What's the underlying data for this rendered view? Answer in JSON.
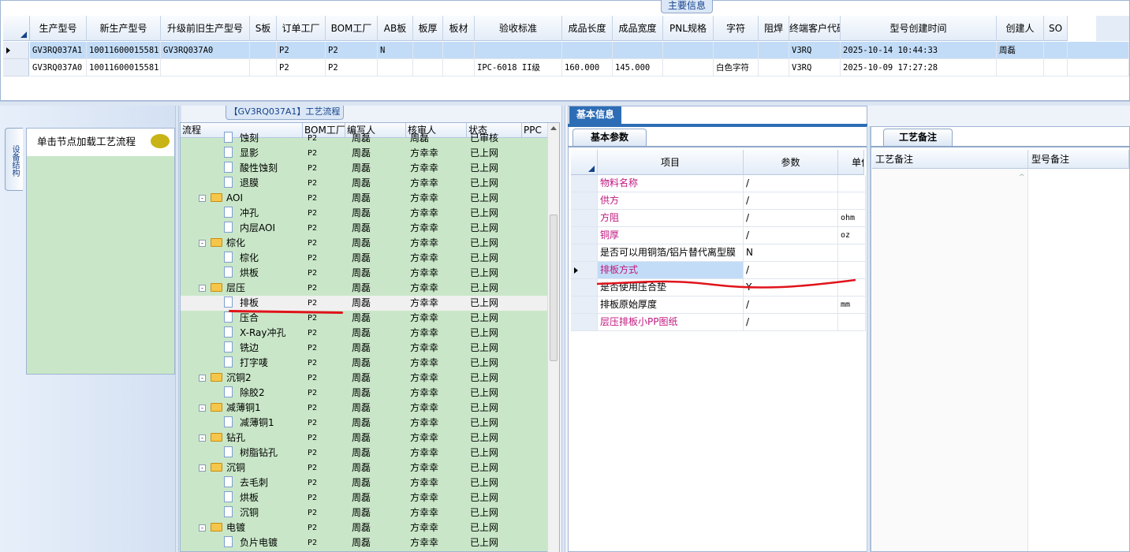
{
  "top": {
    "title": "主要信息",
    "columns": [
      "生产型号",
      "新生产型号",
      "升级前旧生产型号",
      "S板",
      "订单工厂",
      "BOM工厂",
      "AB板",
      "板厚",
      "板材",
      "验收标准",
      "成品长度",
      "成品宽度",
      "PNL规格",
      "字符",
      "阻焊",
      "终端客户代码",
      "型号创建时间",
      "创建人",
      "SO"
    ],
    "rows": [
      [
        "GV3RQ037A1",
        "10011600015581",
        "GV3RQ037A0",
        "",
        "P2",
        "P2",
        "N",
        "",
        "",
        "",
        "",
        "",
        "",
        "",
        "",
        "V3RQ",
        "2025-10-14 10:44:33",
        "周磊",
        ""
      ],
      [
        "GV3RQ037A0",
        "10011600015581",
        "",
        "",
        "P2",
        "P2",
        "",
        "",
        "",
        "IPC-6018 II级",
        "160.000",
        "145.000",
        "",
        "白色字符",
        "",
        "V3RQ",
        "2025-10-09 17:27:28",
        "",
        ""
      ]
    ]
  },
  "left": {
    "vertical_tab": "设备结构",
    "load_button": "单击节点加载工艺流程"
  },
  "tree": {
    "title": "【GV3RQ037A1】工艺流程",
    "columns": [
      "流程",
      "BOM工厂",
      "编写人",
      "核审人",
      "状态",
      "PPC"
    ],
    "rows": [
      {
        "name": "蚀刻",
        "folder": false,
        "level": 2,
        "bom": "P2",
        "writer": "周磊",
        "reviewer": "周磊",
        "status": "已审核"
      },
      {
        "name": "显影",
        "folder": false,
        "level": 2,
        "bom": "P2",
        "writer": "周磊",
        "reviewer": "方幸幸",
        "status": "已上网"
      },
      {
        "name": "酸性蚀刻",
        "folder": false,
        "level": 2,
        "bom": "P2",
        "writer": "周磊",
        "reviewer": "方幸幸",
        "status": "已上网"
      },
      {
        "name": "退膜",
        "folder": false,
        "level": 2,
        "bom": "P2",
        "writer": "周磊",
        "reviewer": "方幸幸",
        "status": "已上网"
      },
      {
        "name": "AOI",
        "folder": true,
        "level": 1,
        "bom": "P2",
        "writer": "周磊",
        "reviewer": "方幸幸",
        "status": "已上网"
      },
      {
        "name": "冲孔",
        "folder": false,
        "level": 2,
        "bom": "P2",
        "writer": "周磊",
        "reviewer": "方幸幸",
        "status": "已上网"
      },
      {
        "name": "内层AOI",
        "folder": false,
        "level": 2,
        "bom": "P2",
        "writer": "周磊",
        "reviewer": "方幸幸",
        "status": "已上网"
      },
      {
        "name": "棕化",
        "folder": true,
        "level": 1,
        "bom": "P2",
        "writer": "周磊",
        "reviewer": "方幸幸",
        "status": "已上网"
      },
      {
        "name": "棕化",
        "folder": false,
        "level": 2,
        "bom": "P2",
        "writer": "周磊",
        "reviewer": "方幸幸",
        "status": "已上网"
      },
      {
        "name": "烘板",
        "folder": false,
        "level": 2,
        "bom": "P2",
        "writer": "周磊",
        "reviewer": "方幸幸",
        "status": "已上网"
      },
      {
        "name": "层压",
        "folder": true,
        "level": 1,
        "bom": "P2",
        "writer": "周磊",
        "reviewer": "方幸幸",
        "status": "已上网"
      },
      {
        "name": "排板",
        "folder": false,
        "level": 2,
        "bom": "P2",
        "writer": "周磊",
        "reviewer": "方幸幸",
        "status": "已上网",
        "selected": true
      },
      {
        "name": "压合",
        "folder": false,
        "level": 2,
        "bom": "P2",
        "writer": "周磊",
        "reviewer": "方幸幸",
        "status": "已上网"
      },
      {
        "name": "X-Ray冲孔",
        "folder": false,
        "level": 2,
        "bom": "P2",
        "writer": "周磊",
        "reviewer": "方幸幸",
        "status": "已上网"
      },
      {
        "name": "铣边",
        "folder": false,
        "level": 2,
        "bom": "P2",
        "writer": "周磊",
        "reviewer": "方幸幸",
        "status": "已上网"
      },
      {
        "name": "打字唛",
        "folder": false,
        "level": 2,
        "bom": "P2",
        "writer": "周磊",
        "reviewer": "方幸幸",
        "status": "已上网"
      },
      {
        "name": "沉铜2",
        "folder": true,
        "level": 1,
        "bom": "P2",
        "writer": "周磊",
        "reviewer": "方幸幸",
        "status": "已上网"
      },
      {
        "name": "除胶2",
        "folder": false,
        "level": 2,
        "bom": "P2",
        "writer": "周磊",
        "reviewer": "方幸幸",
        "status": "已上网"
      },
      {
        "name": "减薄铜1",
        "folder": true,
        "level": 1,
        "bom": "P2",
        "writer": "周磊",
        "reviewer": "方幸幸",
        "status": "已上网"
      },
      {
        "name": "减薄铜1",
        "folder": false,
        "level": 2,
        "bom": "P2",
        "writer": "周磊",
        "reviewer": "方幸幸",
        "status": "已上网"
      },
      {
        "name": "钻孔",
        "folder": true,
        "level": 1,
        "bom": "P2",
        "writer": "周磊",
        "reviewer": "方幸幸",
        "status": "已上网"
      },
      {
        "name": "树脂钻孔",
        "folder": false,
        "level": 2,
        "bom": "P2",
        "writer": "周磊",
        "reviewer": "方幸幸",
        "status": "已上网"
      },
      {
        "name": "沉铜",
        "folder": true,
        "level": 1,
        "bom": "P2",
        "writer": "周磊",
        "reviewer": "方幸幸",
        "status": "已上网"
      },
      {
        "name": "去毛刺",
        "folder": false,
        "level": 2,
        "bom": "P2",
        "writer": "周磊",
        "reviewer": "方幸幸",
        "status": "已上网"
      },
      {
        "name": "烘板",
        "folder": false,
        "level": 2,
        "bom": "P2",
        "writer": "周磊",
        "reviewer": "方幸幸",
        "status": "已上网"
      },
      {
        "name": "沉铜",
        "folder": false,
        "level": 2,
        "bom": "P2",
        "writer": "周磊",
        "reviewer": "方幸幸",
        "status": "已上网"
      },
      {
        "name": "电镀",
        "folder": true,
        "level": 1,
        "bom": "P2",
        "writer": "周磊",
        "reviewer": "方幸幸",
        "status": "已上网"
      },
      {
        "name": "负片电镀",
        "folder": false,
        "level": 2,
        "bom": "P2",
        "writer": "周磊",
        "reviewer": "方幸幸",
        "status": "已上网"
      }
    ]
  },
  "middle": {
    "tab": "基本信息",
    "subtab": "基本参数",
    "columns": [
      "项目",
      "参数",
      "单位"
    ],
    "rows": [
      {
        "item": "物料名称",
        "value": "/",
        "unit": "",
        "pink": true
      },
      {
        "item": "供方",
        "value": "/",
        "unit": "",
        "pink": true
      },
      {
        "item": "方阻",
        "value": "/",
        "unit": "ohm",
        "pink": true
      },
      {
        "item": "铜厚",
        "value": "/",
        "unit": "oz",
        "pink": true
      },
      {
        "item": "是否可以用铜箔/铝片替代离型膜",
        "value": "N",
        "unit": "",
        "pink": false
      },
      {
        "item": "排板方式",
        "value": "/",
        "unit": "",
        "pink": true,
        "selected": true
      },
      {
        "item": "是否使用压合垫",
        "value": "Y",
        "unit": "",
        "pink": false
      },
      {
        "item": "排板原始厚度",
        "value": "/",
        "unit": "mm",
        "pink": false
      },
      {
        "item": "层压排板小PP图纸",
        "value": "/",
        "unit": "",
        "pink": true
      }
    ]
  },
  "right": {
    "tab": "工艺备注",
    "columns": [
      "工艺备注",
      "型号备注"
    ]
  },
  "colors": {
    "tree_bg": "#c9e7c8",
    "accent": "#2d6db5",
    "pink_text": "#c0177f",
    "annotation_red": "#e0141b"
  }
}
